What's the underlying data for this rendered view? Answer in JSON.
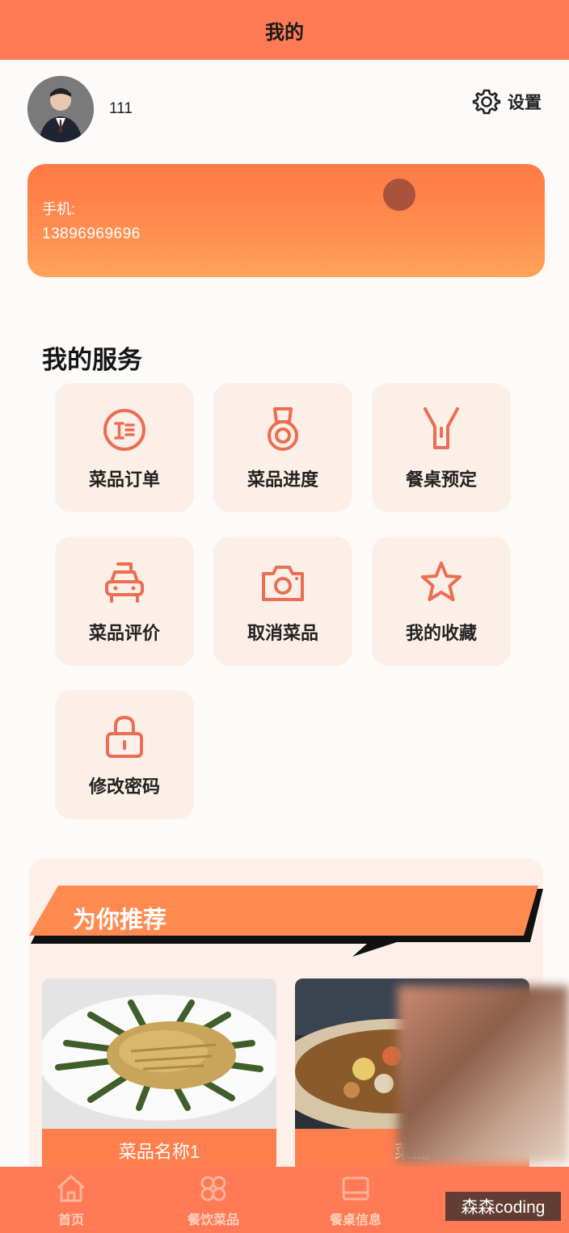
{
  "header": {
    "title": "我的"
  },
  "profile": {
    "username": "111",
    "settings_label": "设置"
  },
  "phone_card": {
    "label": "手机:",
    "value": "13896969696"
  },
  "services": {
    "title": "我的服务",
    "items": [
      {
        "label": "菜品订单",
        "icon": "order-list-icon"
      },
      {
        "label": "菜品进度",
        "icon": "medal-icon"
      },
      {
        "label": "餐桌预定",
        "icon": "flashlight-icon"
      },
      {
        "label": "菜品评价",
        "icon": "car-icon"
      },
      {
        "label": "取消菜品",
        "icon": "camera-icon"
      },
      {
        "label": "我的收藏",
        "icon": "star-icon"
      },
      {
        "label": "修改密码",
        "icon": "lock-icon"
      }
    ]
  },
  "recommend": {
    "title": "为你推荐",
    "items": [
      {
        "name": "菜品名称1"
      },
      {
        "name": "菜品"
      }
    ]
  },
  "tabbar": {
    "items": [
      {
        "label": "首页",
        "icon": "home-icon"
      },
      {
        "label": "餐饮菜品",
        "icon": "grid-icon"
      },
      {
        "label": "餐桌信息",
        "icon": "table-icon"
      }
    ]
  },
  "watermark": "森森coding",
  "colors": {
    "primary": "#ff7a55",
    "accent_orange": "#ff8b4f",
    "tile_bg": "#fcefe8",
    "icon_stroke": "#ec6e52"
  }
}
